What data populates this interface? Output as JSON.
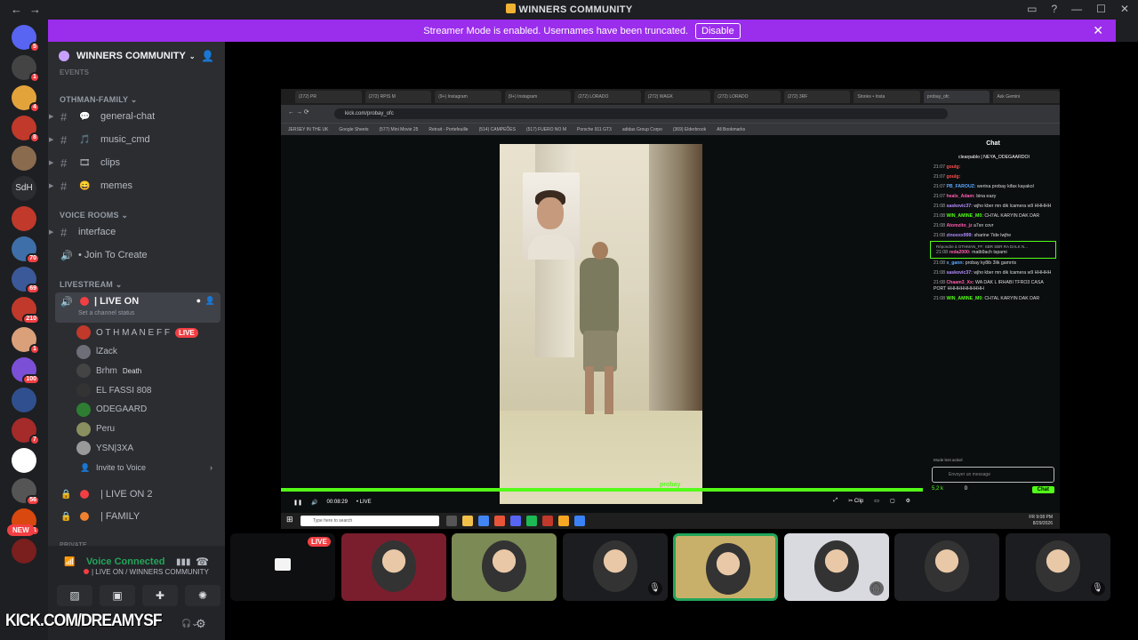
{
  "window": {
    "title": "WINNERS COMMUNITY"
  },
  "banner": {
    "text": "Streamer Mode is enabled. Usernames have been truncated.",
    "button": "Disable"
  },
  "servers": [
    {
      "color": "#5865f2",
      "badge": "5"
    },
    {
      "color": "#444",
      "badge": "1"
    },
    {
      "color": "#e3a33b",
      "badge": "4"
    },
    {
      "color": "#c0392b",
      "badge": "8"
    },
    {
      "color": "#8a6b4e",
      "badge": ""
    },
    {
      "color": "#2b2d31",
      "label": "SdH",
      "badge": ""
    },
    {
      "color": "#c0392b",
      "badge": ""
    },
    {
      "color": "#3f6fa8",
      "badge": "70"
    },
    {
      "color": "#3b5998",
      "badge": "69"
    },
    {
      "color": "#c0392b",
      "badge": "210"
    },
    {
      "color": "#d9a07a",
      "badge": "1"
    },
    {
      "color": "#7b4fd6",
      "badge": "100"
    },
    {
      "color": "#2f4f8f",
      "badge": ""
    },
    {
      "color": "#a52a2a",
      "badge": "7"
    },
    {
      "color": "#fff",
      "badge": ""
    },
    {
      "color": "#555",
      "badge": "56"
    },
    {
      "color": "#d9480f",
      "badge": "1"
    },
    {
      "color": "#7a1e1e",
      "badge": ""
    }
  ],
  "server_new": "NEW",
  "guild": {
    "name": "WINNERS COMMUNITY",
    "events": "EVENTS"
  },
  "categories": {
    "othman": "OTHMAN-FAMILY",
    "voice": "VOICE ROOMS",
    "livestream": "LIVESTREAM",
    "private": "PRIVATE"
  },
  "channels": [
    {
      "name": "general-chat",
      "icon": "💬"
    },
    {
      "name": "music_cmd",
      "icon": "🎵"
    },
    {
      "name": "clips",
      "icon": "🎞"
    },
    {
      "name": "memes",
      "icon": "😄"
    }
  ],
  "voice_channels": [
    {
      "name": "interface"
    },
    {
      "name": "• Join To Create"
    }
  ],
  "live_channel": {
    "name": "| LIVE ON",
    "status": "Set a channel status"
  },
  "users": [
    {
      "name": "O T H M A N E F F",
      "live": "LIVE",
      "color": "#c0392b"
    },
    {
      "name": "lZack",
      "live": "",
      "color": "#6d6f78"
    },
    {
      "name": "Brhm",
      "tag": "Death",
      "live": "",
      "color": "#444"
    },
    {
      "name": "EL FASSI 808",
      "live": "",
      "color": "#333"
    },
    {
      "name": "ODEGAARD",
      "live": "",
      "color": "#2e7d32"
    },
    {
      "name": "Peru",
      "live": "",
      "color": "#8a8f60"
    },
    {
      "name": "YSN|3XA",
      "live": "",
      "color": "#999"
    }
  ],
  "invite": "Invite to Voice",
  "locked_channels": [
    {
      "name": "| LIVE ON 2"
    },
    {
      "name": "| FAMILY"
    }
  ],
  "voice_panel": {
    "status": "Voice Connected",
    "sub": "| LIVE ON / WINNERS COMMUNITY"
  },
  "overlay_text": "KICK.COM/DREAMYSF",
  "browser": {
    "tabs": [
      "(272) PR",
      "(272) RPIS M",
      "(9+) Instagram",
      "(9+) Instagram",
      "(272) LORADO",
      "(272) WAGK",
      "(272) LORADO",
      "(272) 3RF",
      "Stories • Insta",
      "probay_ofc",
      "Ask Gemini"
    ],
    "url": "kick.com/probay_ofc",
    "bookmarks": [
      "JERSEY IN THE UK",
      "Google Sheets",
      "(577) Mini Movie 25",
      "Retrait - Portefeuille",
      "(514) CAMPEÕES",
      "(517) FUERO NO M",
      "Porsche 911 GT3",
      "adidas Group Corpo",
      "(369) Elderbrook",
      "All Bookmarks"
    ]
  },
  "player": {
    "time": "00:08:29",
    "live": "• LIVE",
    "clip": "Clip"
  },
  "chat": {
    "title": "Chat",
    "pinned": "clearpablo | NEYA_ODEGAARDOI",
    "messages": [
      {
        "time": "21:07",
        "user": "goulg:",
        "ucolor": "#ff4d4d",
        "text": ""
      },
      {
        "time": "21:07",
        "user": "goulg:",
        "ucolor": "#ff4d4d",
        "text": ""
      },
      {
        "time": "21:07",
        "user": "PB_FAROUZ:",
        "ucolor": "#5aa9ff",
        "text": "werina probay kifax kayakol"
      },
      {
        "time": "21:07",
        "user": "heals_Adam:",
        "ucolor": "#ff5cae",
        "text": "bina eazy"
      },
      {
        "time": "21:08",
        "user": "saskovic37:",
        "ucolor": "#b28dff",
        "text": "wjho kber mn dik lcamera w9 HHHHH"
      },
      {
        "time": "21:08",
        "user": "WIN_AMINE_M0:",
        "ucolor": "#53fc18",
        "text": "CH7AL KARYIN DAK DAR"
      },
      {
        "time": "21:08",
        "user": "Atomzito_jz",
        "ucolor": "#ff5cae",
        "text": "a7sn covr"
      },
      {
        "time": "21:08",
        "user": "zinooxx999:",
        "ucolor": "#b28dff",
        "text": "sharine 7ide lwjhe"
      },
      {
        "time": "21:08",
        "user": "reda2000:",
        "ucolor": "#ff5cae",
        "text": "matb9ach tspami",
        "reply": "Répondre à OTHMAN_FF: SBR SBR RA DALK N..."
      },
      {
        "time": "21:08",
        "user": "x_gann:",
        "ucolor": "#5aa9ff",
        "text": "probay ky8ib 3lik gamrris"
      },
      {
        "time": "21:08",
        "user": "saskovic37:",
        "ucolor": "#b28dff",
        "text": "wjho kber mn dik lcamera w9 HHHHH"
      },
      {
        "time": "21:08",
        "user": "Chaam3_Xx:",
        "ucolor": "#ff5cae",
        "text": "WA DAK L IRHABI TFRO3 CASA PORT HHHHHHHHHHH"
      },
      {
        "time": "21:08",
        "user": "WIN_AMINE_M0:",
        "ucolor": "#53fc18",
        "text": "CH7AL KARYIN DAK DAR"
      }
    ],
    "mode": "Mode lent activé",
    "input_placeholder": "Envoyer un message",
    "kicks": "5,2 k",
    "count": "0",
    "send": "Chat"
  },
  "taskbar": {
    "search": "Type here to search",
    "clock": "9:08 PM",
    "date": "8/29/2026",
    "lang": "FR"
  },
  "video_label": "probay",
  "tiles": [
    {
      "color": "#f4f4f4",
      "kind": "screen",
      "mute": ""
    },
    {
      "color": "#7a1e2e",
      "kind": "avatar",
      "mute": "",
      "live": "LIVE"
    },
    {
      "color": "#7c8a55",
      "kind": "avatar",
      "mute": ""
    },
    {
      "color": "#1c1d20",
      "kind": "avatar",
      "mute": "🎙"
    },
    {
      "color": "#c9b06a",
      "kind": "avatar",
      "mute": "",
      "selected": true
    },
    {
      "color": "#d9d9e0",
      "kind": "avatar",
      "mute": "🎧"
    },
    {
      "color": "#202124",
      "kind": "avatar",
      "mute": ""
    },
    {
      "color": "#1c1d20",
      "kind": "avatar",
      "mute": "🎙"
    }
  ]
}
